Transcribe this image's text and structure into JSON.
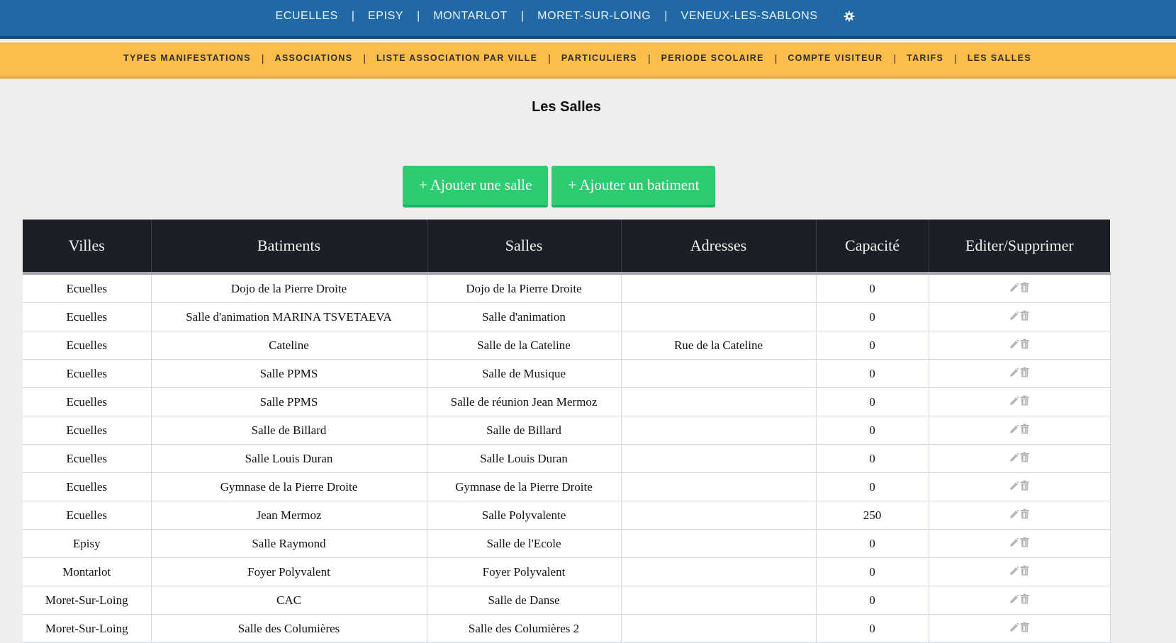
{
  "top_nav": {
    "items": [
      "ECUELLES",
      "EPISY",
      "MONTARLOT",
      "MORET-SUR-LOING",
      "VENEUX-LES-SABLONS"
    ],
    "separator": "|",
    "settings_icon": "gear-icon"
  },
  "sub_nav": {
    "items": [
      "TYPES MANIFESTATIONS",
      "ASSOCIATIONS",
      "LISTE ASSOCIATION PAR VILLE",
      "PARTICULIERS",
      "PERIODE SCOLAIRE",
      "COMPTE VISITEUR",
      "TARIFS",
      "LES SALLES"
    ],
    "separator": "|"
  },
  "page": {
    "title": "Les Salles",
    "add_salle_label": "+ Ajouter une salle",
    "add_batiment_label": "+ Ajouter un batiment"
  },
  "table": {
    "headers": [
      "Villes",
      "Batiments",
      "Salles",
      "Adresses",
      "Capacité",
      "Editer/Supprimer"
    ],
    "rows": [
      [
        "Ecuelles",
        "Dojo de la Pierre Droite",
        "Dojo de la Pierre Droite",
        "",
        "0"
      ],
      [
        "Ecuelles",
        "Salle d'animation MARINA TSVETAEVA",
        "Salle d'animation",
        "",
        "0"
      ],
      [
        "Ecuelles",
        "Cateline",
        "Salle de la Cateline",
        "Rue de la Cateline",
        "0"
      ],
      [
        "Ecuelles",
        "Salle PPMS",
        "Salle de Musique",
        "",
        "0"
      ],
      [
        "Ecuelles",
        "Salle PPMS",
        "Salle de réunion Jean Mermoz",
        "",
        "0"
      ],
      [
        "Ecuelles",
        "Salle de Billard",
        "Salle de Billard",
        "",
        "0"
      ],
      [
        "Ecuelles",
        "Salle Louis Duran",
        "Salle Louis Duran",
        "",
        "0"
      ],
      [
        "Ecuelles",
        "Gymnase de la Pierre Droite",
        "Gymnase de la Pierre Droite",
        "",
        "0"
      ],
      [
        "Ecuelles",
        "Jean Mermoz",
        "Salle Polyvalente",
        "",
        "250"
      ],
      [
        "Episy",
        "Salle Raymond",
        "Salle de l'Ecole",
        "",
        "0"
      ],
      [
        "Montarlot",
        "Foyer Polyvalent",
        "Foyer Polyvalent",
        "",
        "0"
      ],
      [
        "Moret-Sur-Loing",
        "CAC",
        "Salle de Danse",
        "",
        "0"
      ],
      [
        "Moret-Sur-Loing",
        "Salle des Columières",
        "Salle des Columières 2",
        "",
        "0"
      ]
    ],
    "action_icons": [
      "pencil-icon",
      "trash-icon"
    ]
  },
  "colors": {
    "top_nav_bg": "#2068a6",
    "sub_nav_bg": "#fdbd4b",
    "button_green": "#2ecc71",
    "table_header_bg": "#1c1f26",
    "page_bg": "#eeeeee",
    "icon_gray": "#b5b5b5"
  }
}
